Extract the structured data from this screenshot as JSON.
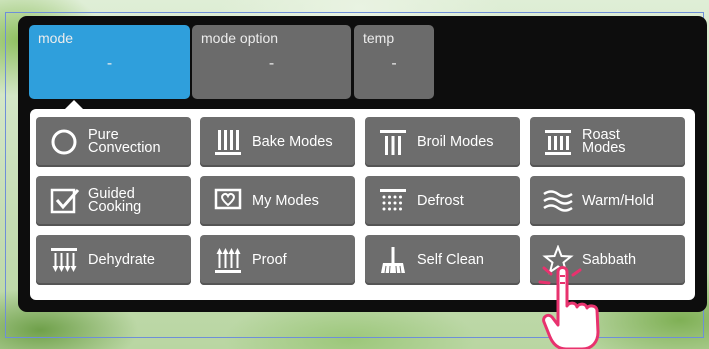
{
  "tabs": [
    {
      "label": "mode",
      "value": "-",
      "active": true
    },
    {
      "label": "mode option",
      "value": "-",
      "active": false
    },
    {
      "label": "temp",
      "value": "-",
      "active": false
    }
  ],
  "modes": [
    {
      "label": "Pure\nConvection",
      "icon": "circle-icon"
    },
    {
      "label": "Bake Modes",
      "icon": "bake-modes-icon"
    },
    {
      "label": "Broil Modes",
      "icon": "broil-modes-icon"
    },
    {
      "label": "Roast\nModes",
      "icon": "roast-modes-icon"
    },
    {
      "label": "Guided\nCooking",
      "icon": "guided-cooking-icon"
    },
    {
      "label": "My Modes",
      "icon": "my-modes-heart-icon"
    },
    {
      "label": "Defrost",
      "icon": "defrost-icon"
    },
    {
      "label": "Warm/Hold",
      "icon": "warm-hold-icon"
    },
    {
      "label": "Dehydrate",
      "icon": "dehydrate-icon"
    },
    {
      "label": "Proof",
      "icon": "proof-icon"
    },
    {
      "label": "Self Clean",
      "icon": "self-clean-broom-icon"
    },
    {
      "label": "Sabbath",
      "icon": "star-icon"
    }
  ],
  "colors": {
    "active_tab": "#2f9fdc",
    "button": "#6d6d6d",
    "hand": "#e8326e"
  }
}
